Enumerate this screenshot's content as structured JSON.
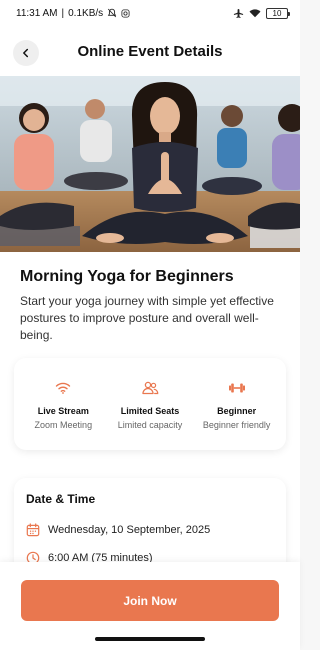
{
  "status_bar": {
    "time": "11:31 AM",
    "network_speed": "0.1KB/s",
    "battery": "10"
  },
  "header": {
    "title": "Online Event Details"
  },
  "event": {
    "title": "Morning Yoga for Beginners",
    "description": "Start your yoga journey with simple yet effective postures to improve posture and overall well-being."
  },
  "features": [
    {
      "icon": "wifi-icon",
      "title": "Live Stream",
      "subtitle": "Zoom Meeting"
    },
    {
      "icon": "users-icon",
      "title": "Limited Seats",
      "subtitle": "Limited capacity"
    },
    {
      "icon": "dumbbell-icon",
      "title": "Beginner",
      "subtitle": "Beginner friendly"
    }
  ],
  "datetime": {
    "heading": "Date & Time",
    "date": "Wednesday, 10 September, 2025",
    "time": "6:00 AM (75 minutes)"
  },
  "actions": {
    "join_label": "Join Now"
  },
  "colors": {
    "accent": "#e9774f",
    "text": "#111111",
    "muted": "#666666"
  }
}
